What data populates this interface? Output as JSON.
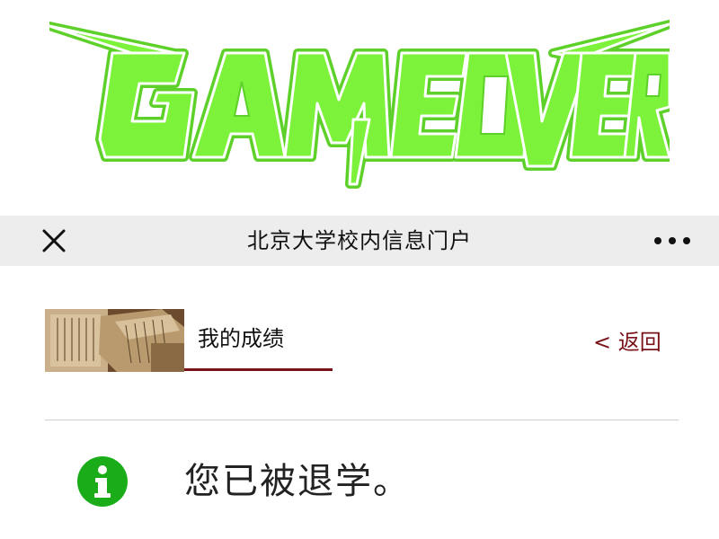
{
  "logo": {
    "text": "GAME OVER",
    "fill_color": "#7cf23a",
    "outline_color": "#ffffff",
    "stroke_color": "#5ed02a"
  },
  "titlebar": {
    "close_icon": "close-icon",
    "title": "北京大学校内信息门户",
    "more_icon": "more-horizontal-icon",
    "background": "#ededed"
  },
  "section": {
    "thumbnail": "ancient-books-image",
    "title": "我的成绩",
    "back_label": "< 返回",
    "accent": "#7a1319"
  },
  "message": {
    "icon": "info-icon",
    "icon_color": "#1aad19",
    "text": "您已被退学。"
  }
}
